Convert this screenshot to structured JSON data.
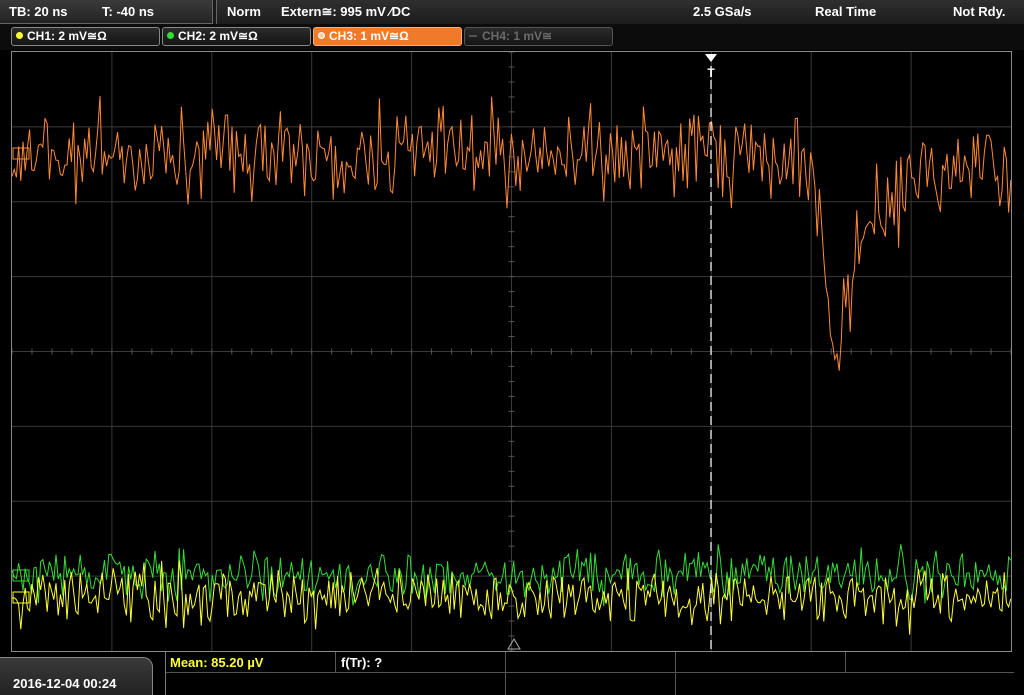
{
  "topbar": {
    "timebase": "TB: 20 ns",
    "trigger_time": "T: -40 ns",
    "mode": "Norm",
    "trigger_source": "Extern≅: 995 mV ⁄DC",
    "sample_rate": "2.5 GSa/s",
    "acq_mode": "Real Time",
    "status": "Not Rdy."
  },
  "channels": [
    {
      "label": "CH1: 2 mV≅Ω",
      "color": "#ffff33",
      "state": "on"
    },
    {
      "label": "CH2: 2 mV≅Ω",
      "color": "#33dd33",
      "state": "on"
    },
    {
      "label": "CH3: 1 mV≅Ω",
      "color": "#ff8a33",
      "state": "active"
    },
    {
      "label": "CH4: 1 mV≅",
      "color": "#555555",
      "state": "off"
    }
  ],
  "markers": {
    "trigger": "T"
  },
  "footer": {
    "datetime": "2016-12-04 00:24",
    "measure_mean": "Mean: 85.20 µV",
    "measure_freq": "f(Tr): ?"
  },
  "colors": {
    "ch1": "#ffff33",
    "ch2": "#33dd33",
    "ch3": "#ff8a33",
    "grid": "#3a3a3a"
  }
}
